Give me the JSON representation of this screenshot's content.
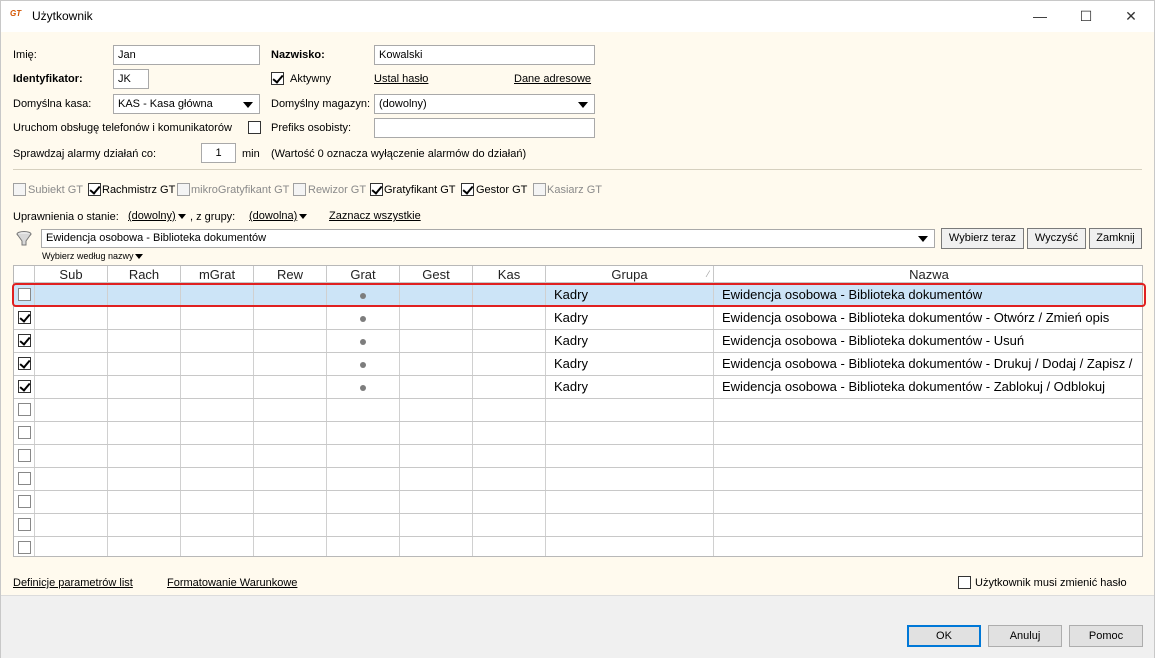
{
  "window": {
    "title": "Użytkownik",
    "app_icon_text": "GT",
    "controls": {
      "minimize": "—",
      "maximize": "☐",
      "close": "✕"
    }
  },
  "form": {
    "first_name_label": "Imię:",
    "first_name_value": "Jan",
    "last_name_label": "Nazwisko:",
    "last_name_value": "Kowalski",
    "id_label": "Identyfikator:",
    "id_value": "JK",
    "active_label": "Aktywny",
    "active_checked": true,
    "set_password_link": "Ustal hasło",
    "address_link": "Dane adresowe",
    "default_cash_label": "Domyślna kasa:",
    "default_cash_value": "KAS - Kasa główna",
    "default_warehouse_label": "Domyślny magazyn:",
    "default_warehouse_value": "(dowolny)",
    "phone_service_label": "Uruchom obsługę telefonów i komunikatorów",
    "phone_service_checked": false,
    "personal_prefix_label": "Prefiks osobisty:",
    "personal_prefix_value": "",
    "alarms_label": "Sprawdzaj alarmy działań co:",
    "alarms_value": "1",
    "alarms_unit": "min",
    "alarms_hint": "(Wartość 0 oznacza wyłączenie alarmów do działań)"
  },
  "modules": [
    {
      "label": "Subiekt GT",
      "checked": false,
      "enabled": false
    },
    {
      "label": "Rachmistrz GT",
      "checked": true,
      "enabled": true
    },
    {
      "label": "mikroGratyfikant GT",
      "checked": false,
      "enabled": false
    },
    {
      "label": "Rewizor GT",
      "checked": false,
      "enabled": false
    },
    {
      "label": "Gratyfikant GT",
      "checked": true,
      "enabled": true
    },
    {
      "label": "Gestor GT",
      "checked": true,
      "enabled": true
    },
    {
      "label": "Kasiarz GT",
      "checked": false,
      "enabled": false
    }
  ],
  "permissions": {
    "state_label": "Uprawnienia o stanie:",
    "state_value": "(dowolny)",
    "group_label": ", z grupy:",
    "group_value": "(dowolna)",
    "select_all_link": "Zaznacz wszystkie",
    "filter_value": "Ewidencja osobowa - Biblioteka dokumentów",
    "choose_by_name": "Wybierz według nazwy",
    "btn_choose_now": "Wybierz teraz",
    "btn_clear": "Wyczyść",
    "btn_close": "Zamknij"
  },
  "grid": {
    "columns": [
      "Sub",
      "Rach",
      "mGrat",
      "Rew",
      "Grat",
      "Gest",
      "Kas",
      "Grupa",
      "Nazwa"
    ],
    "sort_indicator": "⁄",
    "rows": [
      {
        "checked": false,
        "grat_dot": true,
        "group": "Kadry",
        "name": "Ewidencja osobowa - Biblioteka dokumentów",
        "selected": true
      },
      {
        "checked": true,
        "grat_dot": true,
        "group": "Kadry",
        "name": "Ewidencja osobowa - Biblioteka dokumentów - Otwórz / Zmień opis",
        "selected": false
      },
      {
        "checked": true,
        "grat_dot": true,
        "group": "Kadry",
        "name": "Ewidencja osobowa - Biblioteka dokumentów - Usuń",
        "selected": false
      },
      {
        "checked": true,
        "grat_dot": true,
        "group": "Kadry",
        "name": "Ewidencja osobowa - Biblioteka dokumentów - Drukuj / Dodaj / Zapisz /",
        "selected": false
      },
      {
        "checked": true,
        "grat_dot": true,
        "group": "Kadry",
        "name": "Ewidencja osobowa - Biblioteka dokumentów - Zablokuj / Odblokuj",
        "selected": false
      },
      {
        "checked": false,
        "grat_dot": false,
        "group": "",
        "name": "",
        "selected": false
      },
      {
        "checked": false,
        "grat_dot": false,
        "group": "",
        "name": "",
        "selected": false
      },
      {
        "checked": false,
        "grat_dot": false,
        "group": "",
        "name": "",
        "selected": false
      },
      {
        "checked": false,
        "grat_dot": false,
        "group": "",
        "name": "",
        "selected": false
      },
      {
        "checked": false,
        "grat_dot": false,
        "group": "",
        "name": "",
        "selected": false
      },
      {
        "checked": false,
        "grat_dot": false,
        "group": "",
        "name": "",
        "selected": false
      },
      {
        "checked": false,
        "grat_dot": false,
        "group": "",
        "name": "",
        "selected": false
      }
    ]
  },
  "footer": {
    "list_params_link": "Definicje parametrów list",
    "conditional_format_link": "Formatowanie Warunkowe",
    "must_change_password_label": "Użytkownik musi zmienić hasło",
    "must_change_password_checked": false,
    "ok": "OK",
    "cancel": "Anuluj",
    "help": "Pomoc"
  }
}
